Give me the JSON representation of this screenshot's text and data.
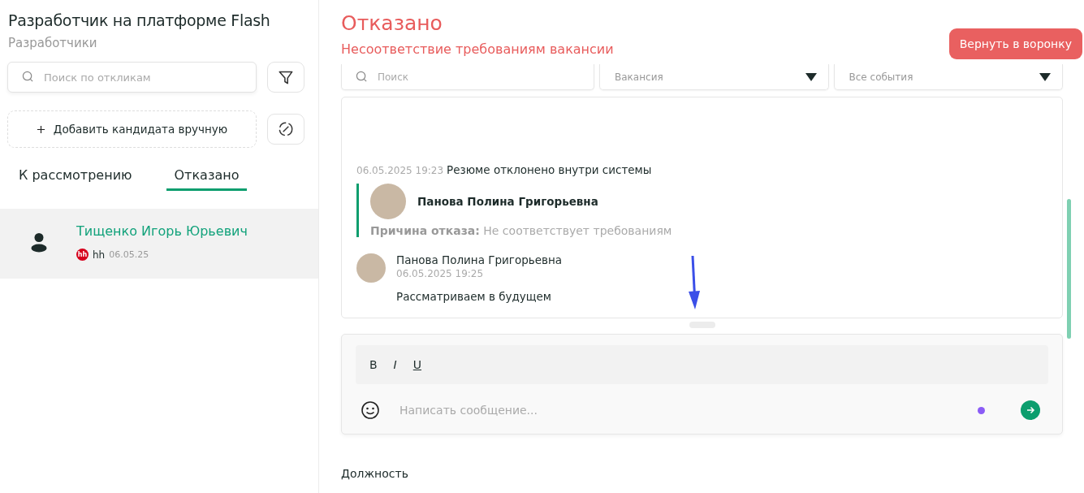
{
  "vacancy": {
    "title": "Разработчик на платформе Flash",
    "department": "Разработчики"
  },
  "sidebar": {
    "search": {
      "placeholder": "Поиск по откликам"
    },
    "add_button": "Добавить кандидата вручную",
    "tabs": [
      {
        "label": "К рассмотрению",
        "selected": false
      },
      {
        "label": "Отказано",
        "selected": true
      }
    ],
    "candidates": [
      {
        "name": "Тищенко Игорь Юрьевич",
        "source_badge": "hh",
        "source": "hh",
        "date": "06.05.25",
        "selected": true
      }
    ]
  },
  "status": {
    "title": "Отказано",
    "reason": "Несоответствие требованиям вакансии",
    "return_button": "Вернуть в воронку"
  },
  "filters": {
    "search": {
      "placeholder": "Поиск"
    },
    "dropdowns": [
      {
        "placeholder": "Вакансия"
      },
      {
        "placeholder": "Все события"
      }
    ]
  },
  "events": [
    {
      "kind": "rejection",
      "time": "06.05.2025 19:23",
      "text": "Резюме отклонено внутри системы",
      "author": "Панова Полина Григорьевна",
      "reason": "**Причина отказа:** Не соответствует требованиям"
    },
    {
      "kind": "comment",
      "author": "Панова Полина Григорьевна",
      "time": "06.05.2025 19:25",
      "text": "Рассматриваем в будущем"
    }
  ],
  "composer": {
    "format_buttons": [
      {
        "label": "B",
        "kind": "bold"
      },
      {
        "label": "I",
        "kind": "italic"
      },
      {
        "label": "U",
        "kind": "underline"
      }
    ],
    "placeholder": "Написать сообщение..."
  },
  "section_label": "Должность"
}
